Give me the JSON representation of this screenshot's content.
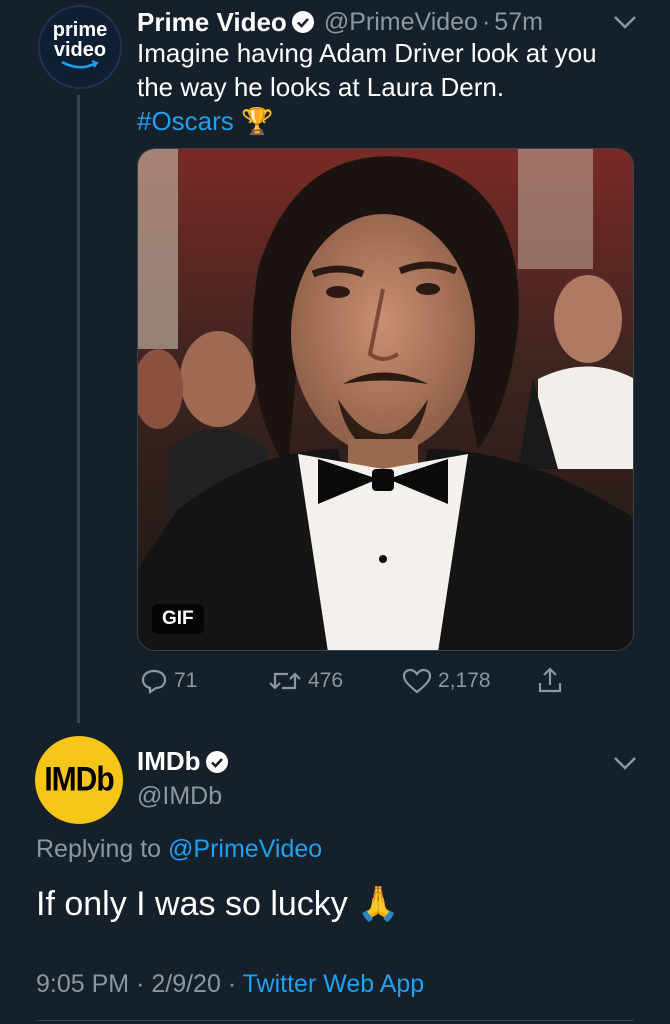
{
  "tweet": {
    "author_name": "Prime Video",
    "author_handle": "@PrimeVideo",
    "separator": "·",
    "time_ago": "57m",
    "avatar_text_line1": "prime",
    "avatar_text_line2": "video",
    "text_line1": "Imagine having Adam Driver look at you",
    "text_line2": "the way he looks at Laura Dern.",
    "hashtag": "#Oscars",
    "hashtag_emoji": "🏆",
    "media_badge": "GIF",
    "actions": {
      "replies": "71",
      "retweets": "476",
      "likes": "2,178"
    }
  },
  "reply": {
    "author_name": "IMDb",
    "author_handle": "@IMDb",
    "avatar_text": "IMDb",
    "replying_to_label": "Replying to",
    "replying_to_handle": "@PrimeVideo",
    "text": "If only I was so lucky",
    "emoji": "🙏",
    "time": "9:05 PM",
    "separator": "·",
    "date": "2/9/20",
    "source": "Twitter Web App"
  },
  "colors": {
    "background": "#15202b",
    "secondary_text": "#8899a6",
    "link": "#1da1f2",
    "imdb_yellow": "#f5c518"
  },
  "icons": [
    "verified-badge-icon",
    "chevron-down-icon",
    "reply-icon",
    "retweet-icon",
    "like-icon",
    "share-icon"
  ]
}
